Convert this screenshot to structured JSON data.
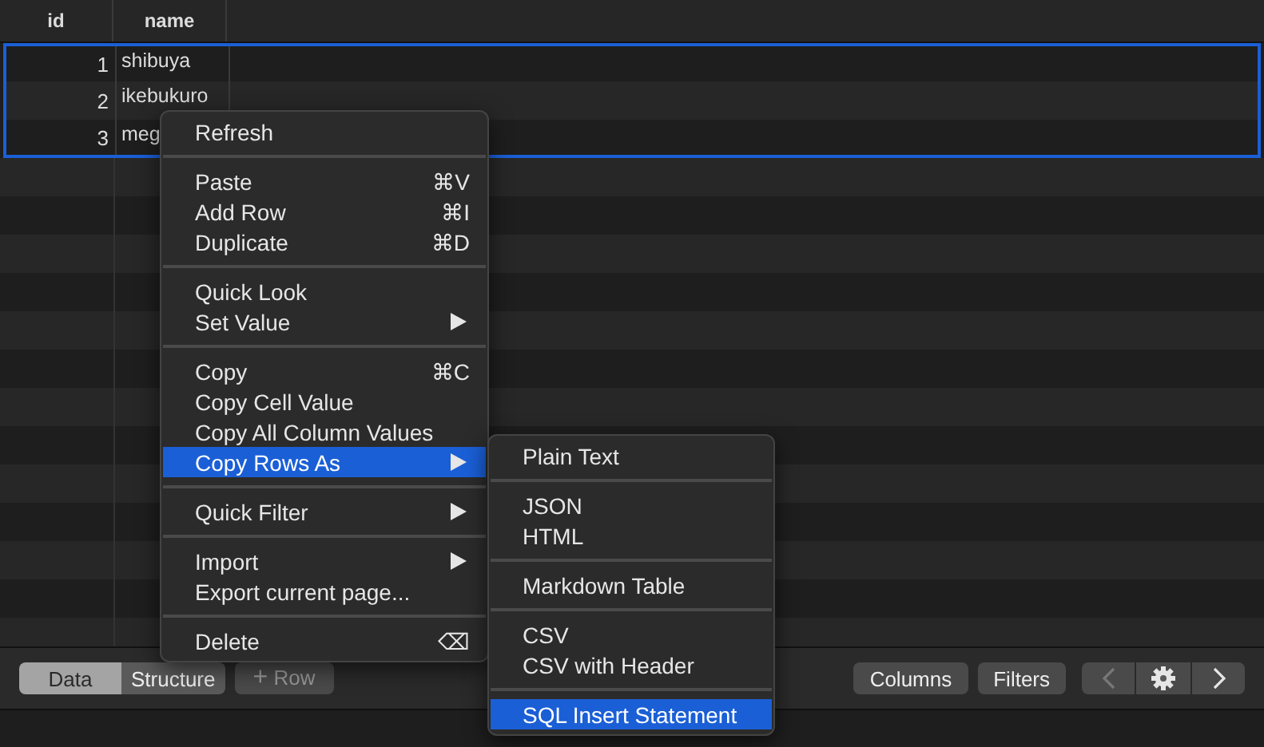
{
  "table": {
    "columns": [
      "id",
      "name"
    ],
    "rows": [
      {
        "id": "1",
        "name": "shibuya",
        "selected": true
      },
      {
        "id": "2",
        "name": "ikebukuro",
        "selected": true
      },
      {
        "id": "3",
        "name": "meg",
        "selected": true
      }
    ]
  },
  "context_menu": {
    "sections": [
      [
        {
          "label": "Refresh",
          "selected": false
        }
      ],
      [
        {
          "label": "Paste",
          "shortcut": "⌘V",
          "selected": false
        },
        {
          "label": "Add Row",
          "shortcut": "⌘I",
          "selected": false
        },
        {
          "label": "Duplicate",
          "shortcut": "⌘D",
          "selected": false
        }
      ],
      [
        {
          "label": "Quick Look",
          "selected": false
        },
        {
          "label": "Set Value",
          "submenu": true,
          "selected": false
        }
      ],
      [
        {
          "label": "Copy",
          "shortcut": "⌘C",
          "selected": false
        },
        {
          "label": "Copy Cell Value",
          "selected": false
        },
        {
          "label": "Copy All Column Values",
          "selected": false
        },
        {
          "label": "Copy Rows As",
          "submenu": true,
          "selected": true
        }
      ],
      [
        {
          "label": "Quick Filter",
          "submenu": true,
          "selected": false
        }
      ],
      [
        {
          "label": "Import",
          "submenu": true,
          "selected": false
        },
        {
          "label": "Export current page...",
          "selected": false
        }
      ],
      [
        {
          "label": "Delete",
          "shortcut": "⌫",
          "selected": false
        }
      ]
    ]
  },
  "submenu": {
    "sections": [
      [
        {
          "label": "Plain Text",
          "selected": false
        }
      ],
      [
        {
          "label": "JSON",
          "selected": false
        },
        {
          "label": "HTML",
          "selected": false
        }
      ],
      [
        {
          "label": "Markdown Table",
          "selected": false
        }
      ],
      [
        {
          "label": "CSV",
          "selected": false
        },
        {
          "label": "CSV with Header",
          "selected": false
        }
      ],
      [
        {
          "label": "SQL Insert Statement",
          "selected": true
        }
      ]
    ]
  },
  "toolbar": {
    "view_tabs": [
      {
        "label": "Data",
        "selected": true
      },
      {
        "label": "Structure",
        "selected": false
      }
    ],
    "add_row": {
      "icon": "+",
      "label": "Row"
    },
    "buttons": [
      "Columns",
      "Filters"
    ]
  }
}
